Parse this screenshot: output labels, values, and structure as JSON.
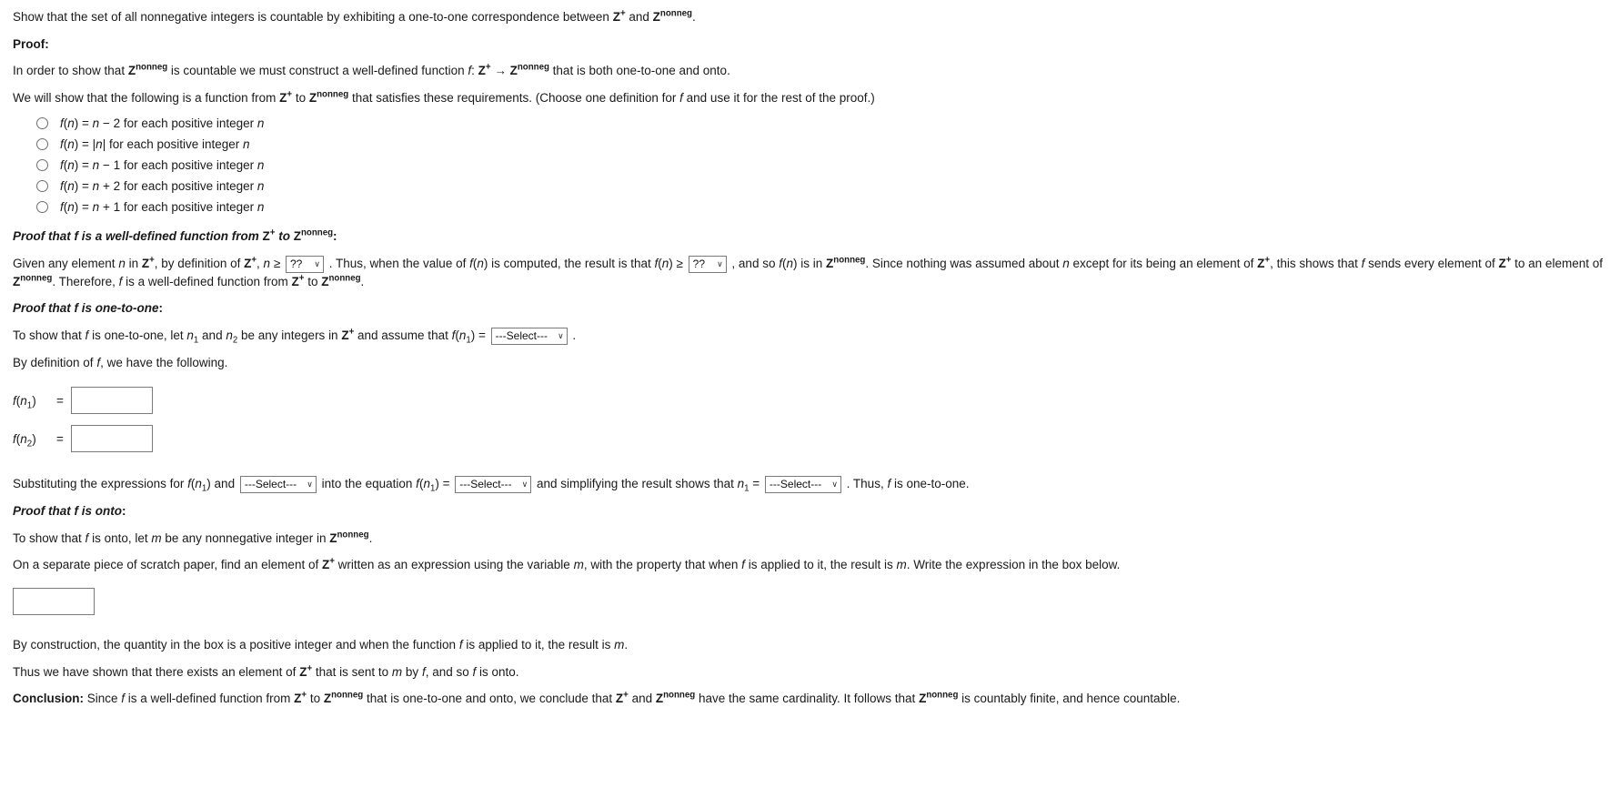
{
  "problem": {
    "statement_pre": "Show that the set of all nonnegative integers is countable by exhibiting a one-to-one correspondence between ",
    "zplus": "Z",
    "plus_sup": "+",
    "znonneg": "Z",
    "nonneg_sup": "nonneg",
    "statement_mid": " and ",
    "statement_end": "."
  },
  "proof_heading": "Proof",
  "colon": ":",
  "intro": {
    "part1": "In order to show that ",
    "part2": " is countable we must construct a well-defined function ",
    "f_italic": "f",
    "part3": ": ",
    "arrow": " → ",
    "part4": " that is both one-to-one and onto."
  },
  "instructions": {
    "part1": "We will show that the following is a function from ",
    "part2": " to ",
    "part3": " that satisfies these requirements. (Choose one definition for ",
    "f_italic": "f",
    "part4": " and use it for the rest of the proof.)"
  },
  "choices": [
    {
      "id": "choice-1",
      "formula_html": "n − 2",
      "prefix": "f(n) = ",
      "suffix": " for each positive integer n",
      "selected": false
    },
    {
      "id": "choice-2",
      "formula_html": "|n|",
      "prefix": "f(n) = ",
      "suffix": " for each positive integer n",
      "selected": false
    },
    {
      "id": "choice-3",
      "formula_html": "n − 1",
      "prefix": "f(n) = ",
      "suffix": " for each positive integer n",
      "selected": false
    },
    {
      "id": "choice-4",
      "formula_html": "n + 2",
      "prefix": "f(n) = ",
      "suffix": " for each positive integer n",
      "selected": false
    },
    {
      "id": "choice-5",
      "formula_html": "n + 1",
      "prefix": "f(n) = ",
      "suffix": " for each positive integer n",
      "selected": false
    }
  ],
  "well_defined": {
    "heading_pre": "Proof that f is a well-defined function from ",
    "heading_to": " to ",
    "heading_colon": ":",
    "t1": "Given any element ",
    "n_italic": "n",
    "t2": " in ",
    "t3": ", by definition of ",
    "t4": ", ",
    "t5": " ≥ ",
    "select_1_value": "??",
    "t6": " . Thus, when the value of ",
    "t7": " is computed, the result is that ",
    "t8": " ≥ ",
    "select_2_value": "??",
    "t9": " , and so ",
    "t10": " is in ",
    "t11": ". Since nothing was assumed about ",
    "t12": " except for its being an element of ",
    "t13": ", this shows that ",
    "t14": " sends every element of ",
    "t15": " to an element of ",
    "t16": ". Therefore, ",
    "t17": " is a well-defined function from ",
    "t18": " to ",
    "t19": "."
  },
  "one_to_one": {
    "heading": "Proof that f is one-to-one",
    "heading_colon": ":",
    "s1": "To show that ",
    "s2": " is one-to-one, let ",
    "n1": "n",
    "sub1": "1",
    "s3": " and ",
    "n2": "n",
    "sub2": "2",
    "s4": " be any integers in ",
    "s5": " and assume that ",
    "s6": "f(n",
    "s7": ") = ",
    "select_value": "---Select---",
    "s8": " .",
    "bydef": "By definition of f, we have the following.",
    "eq1_label": "f(n",
    "eq1_sub": "1",
    "eq1_close": ")",
    "eq1_eq": "=",
    "eq1_value": "",
    "eq2_label": "f(n",
    "eq2_sub": "2",
    "eq2_close": ")",
    "eq2_eq": "=",
    "eq2_value": "",
    "sub_t1": "Substituting the expressions for ",
    "sub_fn1": "f(n",
    "sub_fn1_sub": "1",
    "sub_fn1_close": ")",
    "sub_t2": " and ",
    "sub_select_1": "---Select---",
    "sub_t3": " into the equation ",
    "sub_t4": " = ",
    "sub_select_2": "---Select---",
    "sub_t5": " and simplifying the result shows that ",
    "sub_n1": "n",
    "sub_n1_sub": "1",
    "sub_t6": " = ",
    "sub_select_3": "---Select---",
    "sub_t7": " . Thus, ",
    "sub_t8": " is one-to-one."
  },
  "onto": {
    "heading": "Proof that f is onto",
    "heading_colon": ":",
    "o1": "To show that ",
    "o2": " is onto, let ",
    "m_italic": "m",
    "o3": " be any nonnegative integer in ",
    "o4": ".",
    "scratch_1": "On a separate piece of scratch paper, find an element of ",
    "scratch_2": " written as an expression using the variable ",
    "scratch_3": ", with the property that when ",
    "scratch_4": " is applied to it, the result is ",
    "scratch_5": ". Write the expression in the box below.",
    "answer_value": "",
    "construction_1": "By construction, the quantity in the box is a positive integer and when the function ",
    "construction_2": " is applied to it, the result is ",
    "construction_3": ".",
    "thus_1": "Thus we have shown that there exists an element of ",
    "thus_2": " that is sent to ",
    "thus_3": " by ",
    "thus_4": ", and so ",
    "thus_5": " is onto."
  },
  "conclusion": {
    "label": "Conclusion",
    "label_colon": ":",
    "c1": " Since ",
    "c2": " is a well-defined function from ",
    "c3": " to ",
    "c4": " that is one-to-one and onto, we conclude that ",
    "c5": " and ",
    "c6": " have the same cardinality. It follows that ",
    "c7": " is countably finite, and hence countable."
  },
  "icons": {
    "caret_down": "∨"
  },
  "colors": {
    "text": "#1a1a1a",
    "border": "#7a7a7a",
    "background": "#ffffff"
  }
}
